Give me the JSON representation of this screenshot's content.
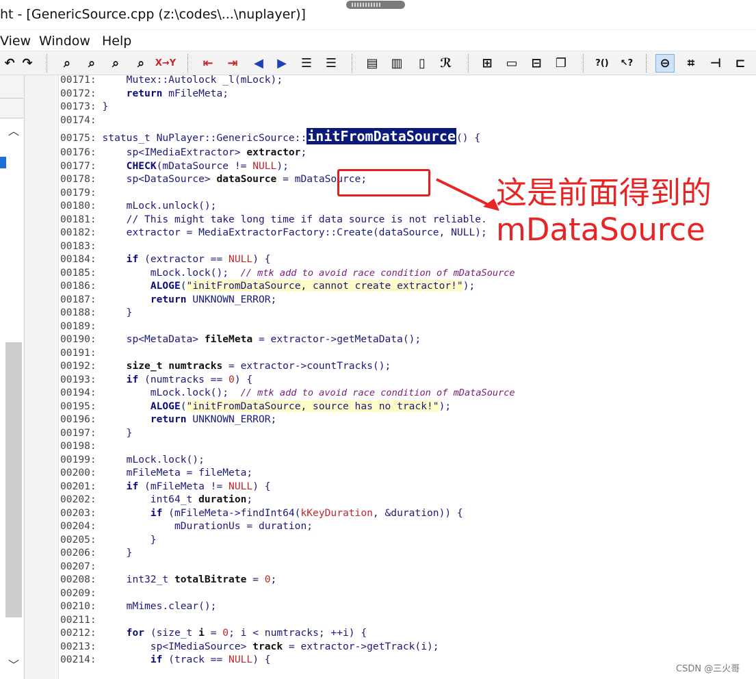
{
  "window": {
    "title": "ht - [GenericSource.cpp (z:\\codes\\...\\nuplayer)]"
  },
  "menu": [
    "View",
    "Window",
    "Help"
  ],
  "toolbar": {
    "swap_label": "X→Y",
    "question_label": "?()",
    "help_label": "↖?"
  },
  "code_lines": [
    {
      "n": "00171:",
      "tokens": [
        {
          "t": "    Mutex::Autolock _l(mLock);",
          "c": "tx"
        }
      ]
    },
    {
      "n": "00172:",
      "tokens": [
        {
          "t": "    ",
          "c": "tx"
        },
        {
          "t": "return",
          "c": "kw"
        },
        {
          "t": " mFileMeta;",
          "c": "tx"
        }
      ]
    },
    {
      "n": "00173:",
      "tokens": [
        {
          "t": "}",
          "c": "tx"
        }
      ]
    },
    {
      "n": "00174:",
      "tokens": []
    },
    {
      "n": "00175:",
      "tall": true,
      "tokens": [
        {
          "t": "status_t NuPlayer::GenericSource::",
          "c": "tx"
        },
        {
          "t": "initFromDataSource",
          "c": "hl"
        },
        {
          "t": "() {",
          "c": "tx"
        }
      ]
    },
    {
      "n": "00176:",
      "tokens": [
        {
          "t": "    sp<IMediaExtractor> ",
          "c": "tx"
        },
        {
          "t": "extractor",
          "c": "id"
        },
        {
          "t": ";",
          "c": "tx"
        }
      ]
    },
    {
      "n": "00177:",
      "tokens": [
        {
          "t": "    ",
          "c": "tx"
        },
        {
          "t": "CHECK",
          "c": "kw"
        },
        {
          "t": "(mDataSource != ",
          "c": "tx"
        },
        {
          "t": "NULL",
          "c": "num"
        },
        {
          "t": ");",
          "c": "tx"
        }
      ]
    },
    {
      "n": "00178:",
      "tokens": [
        {
          "t": "    sp<DataSource> ",
          "c": "tx"
        },
        {
          "t": "dataSource",
          "c": "id"
        },
        {
          "t": " = mDataSource;",
          "c": "tx"
        }
      ]
    },
    {
      "n": "00179:",
      "tokens": []
    },
    {
      "n": "00180:",
      "tokens": [
        {
          "t": "    mLock.unlock();",
          "c": "tx"
        }
      ]
    },
    {
      "n": "00181:",
      "tokens": [
        {
          "t": "    // This might take long time if data source is not reliable.",
          "c": "tx"
        }
      ]
    },
    {
      "n": "00182:",
      "tokens": [
        {
          "t": "    extractor = MediaExtractorFactory::Create(dataSource, NULL);",
          "c": "tx"
        }
      ]
    },
    {
      "n": "00183:",
      "tokens": []
    },
    {
      "n": "00184:",
      "tokens": [
        {
          "t": "    ",
          "c": "tx"
        },
        {
          "t": "if",
          "c": "kw"
        },
        {
          "t": " (extractor == ",
          "c": "tx"
        },
        {
          "t": "NULL",
          "c": "num"
        },
        {
          "t": ") {",
          "c": "tx"
        }
      ]
    },
    {
      "n": "00185:",
      "tokens": [
        {
          "t": "        mLock.lock();  ",
          "c": "tx"
        },
        {
          "t": "// mtk add to avoid race condition of mDataSource",
          "c": "cm"
        }
      ]
    },
    {
      "n": "00186:",
      "tokens": [
        {
          "t": "        ",
          "c": "tx"
        },
        {
          "t": "ALOGE",
          "c": "kw"
        },
        {
          "t": "(",
          "c": "tx"
        },
        {
          "t": "\"initFromDataSource, cannot create extractor!\"",
          "c": "str"
        },
        {
          "t": ");",
          "c": "tx"
        }
      ]
    },
    {
      "n": "00187:",
      "tokens": [
        {
          "t": "        ",
          "c": "tx"
        },
        {
          "t": "return",
          "c": "kw"
        },
        {
          "t": " UNKNOWN_ERROR;",
          "c": "tx"
        }
      ]
    },
    {
      "n": "00188:",
      "tokens": [
        {
          "t": "    }",
          "c": "tx"
        }
      ]
    },
    {
      "n": "00189:",
      "tokens": []
    },
    {
      "n": "00190:",
      "tokens": [
        {
          "t": "    sp<MetaData> ",
          "c": "tx"
        },
        {
          "t": "fileMeta",
          "c": "id"
        },
        {
          "t": " = extractor->getMetaData();",
          "c": "tx"
        }
      ]
    },
    {
      "n": "00191:",
      "tokens": []
    },
    {
      "n": "00192:",
      "tokens": [
        {
          "t": "    ",
          "c": "tx"
        },
        {
          "t": "size_t",
          "c": "id"
        },
        {
          "t": " ",
          "c": "tx"
        },
        {
          "t": "numtracks",
          "c": "id"
        },
        {
          "t": " = extractor->countTracks();",
          "c": "tx"
        }
      ]
    },
    {
      "n": "00193:",
      "tokens": [
        {
          "t": "    ",
          "c": "tx"
        },
        {
          "t": "if",
          "c": "kw"
        },
        {
          "t": " (numtracks == ",
          "c": "tx"
        },
        {
          "t": "0",
          "c": "num"
        },
        {
          "t": ") {",
          "c": "tx"
        }
      ]
    },
    {
      "n": "00194:",
      "tokens": [
        {
          "t": "        mLock.lock();  ",
          "c": "tx"
        },
        {
          "t": "// mtk add to avoid race condition of mDataSource",
          "c": "cm"
        }
      ]
    },
    {
      "n": "00195:",
      "tokens": [
        {
          "t": "        ",
          "c": "tx"
        },
        {
          "t": "ALOGE",
          "c": "kw"
        },
        {
          "t": "(",
          "c": "tx"
        },
        {
          "t": "\"initFromDataSource, source has no track!\"",
          "c": "str"
        },
        {
          "t": ");",
          "c": "tx"
        }
      ]
    },
    {
      "n": "00196:",
      "tokens": [
        {
          "t": "        ",
          "c": "tx"
        },
        {
          "t": "return",
          "c": "kw"
        },
        {
          "t": " UNKNOWN_ERROR;",
          "c": "tx"
        }
      ]
    },
    {
      "n": "00197:",
      "tokens": [
        {
          "t": "    }",
          "c": "tx"
        }
      ]
    },
    {
      "n": "00198:",
      "tokens": []
    },
    {
      "n": "00199:",
      "tokens": [
        {
          "t": "    mLock.lock();",
          "c": "tx"
        }
      ]
    },
    {
      "n": "00200:",
      "tokens": [
        {
          "t": "    mFileMeta = fileMeta;",
          "c": "tx"
        }
      ]
    },
    {
      "n": "00201:",
      "tokens": [
        {
          "t": "    ",
          "c": "tx"
        },
        {
          "t": "if",
          "c": "kw"
        },
        {
          "t": " (mFileMeta != ",
          "c": "tx"
        },
        {
          "t": "NULL",
          "c": "num"
        },
        {
          "t": ") {",
          "c": "tx"
        }
      ]
    },
    {
      "n": "00202:",
      "tokens": [
        {
          "t": "        int64_t ",
          "c": "tx"
        },
        {
          "t": "duration",
          "c": "id"
        },
        {
          "t": ";",
          "c": "tx"
        }
      ]
    },
    {
      "n": "00203:",
      "tokens": [
        {
          "t": "        ",
          "c": "tx"
        },
        {
          "t": "if",
          "c": "kw"
        },
        {
          "t": " (mFileMeta->findInt64(",
          "c": "tx"
        },
        {
          "t": "kKeyDuration",
          "c": "num"
        },
        {
          "t": ", &duration)) {",
          "c": "tx"
        }
      ]
    },
    {
      "n": "00204:",
      "tokens": [
        {
          "t": "            mDurationUs = duration;",
          "c": "tx"
        }
      ]
    },
    {
      "n": "00205:",
      "tokens": [
        {
          "t": "        }",
          "c": "tx"
        }
      ]
    },
    {
      "n": "00206:",
      "tokens": [
        {
          "t": "    }",
          "c": "tx"
        }
      ]
    },
    {
      "n": "00207:",
      "tokens": []
    },
    {
      "n": "00208:",
      "tokens": [
        {
          "t": "    int32_t ",
          "c": "tx"
        },
        {
          "t": "totalBitrate",
          "c": "id"
        },
        {
          "t": " = ",
          "c": "tx"
        },
        {
          "t": "0",
          "c": "num"
        },
        {
          "t": ";",
          "c": "tx"
        }
      ]
    },
    {
      "n": "00209:",
      "tokens": []
    },
    {
      "n": "00210:",
      "tokens": [
        {
          "t": "    mMimes.clear();",
          "c": "tx"
        }
      ]
    },
    {
      "n": "00211:",
      "tokens": []
    },
    {
      "n": "00212:",
      "tokens": [
        {
          "t": "    ",
          "c": "tx"
        },
        {
          "t": "for",
          "c": "kw"
        },
        {
          "t": " (size_t ",
          "c": "tx"
        },
        {
          "t": "i",
          "c": "id"
        },
        {
          "t": " = ",
          "c": "tx"
        },
        {
          "t": "0",
          "c": "num"
        },
        {
          "t": "; i < numtracks; ++i) {",
          "c": "tx"
        }
      ]
    },
    {
      "n": "00213:",
      "tokens": [
        {
          "t": "        sp<IMediaSource> ",
          "c": "tx"
        },
        {
          "t": "track",
          "c": "id"
        },
        {
          "t": " = extractor->getTrack(i);",
          "c": "tx"
        }
      ]
    },
    {
      "n": "00214:",
      "tokens": [
        {
          "t": "        ",
          "c": "tx"
        },
        {
          "t": "if",
          "c": "kw"
        },
        {
          "t": " (track == ",
          "c": "tx"
        },
        {
          "t": "NULL",
          "c": "num"
        },
        {
          "t": ") {",
          "c": "tx"
        }
      ]
    }
  ],
  "annotation": {
    "line1": "这是前面得到的",
    "line2": "mDataSource",
    "color": "#e82525"
  },
  "watermark": "CSDN @三火哥"
}
